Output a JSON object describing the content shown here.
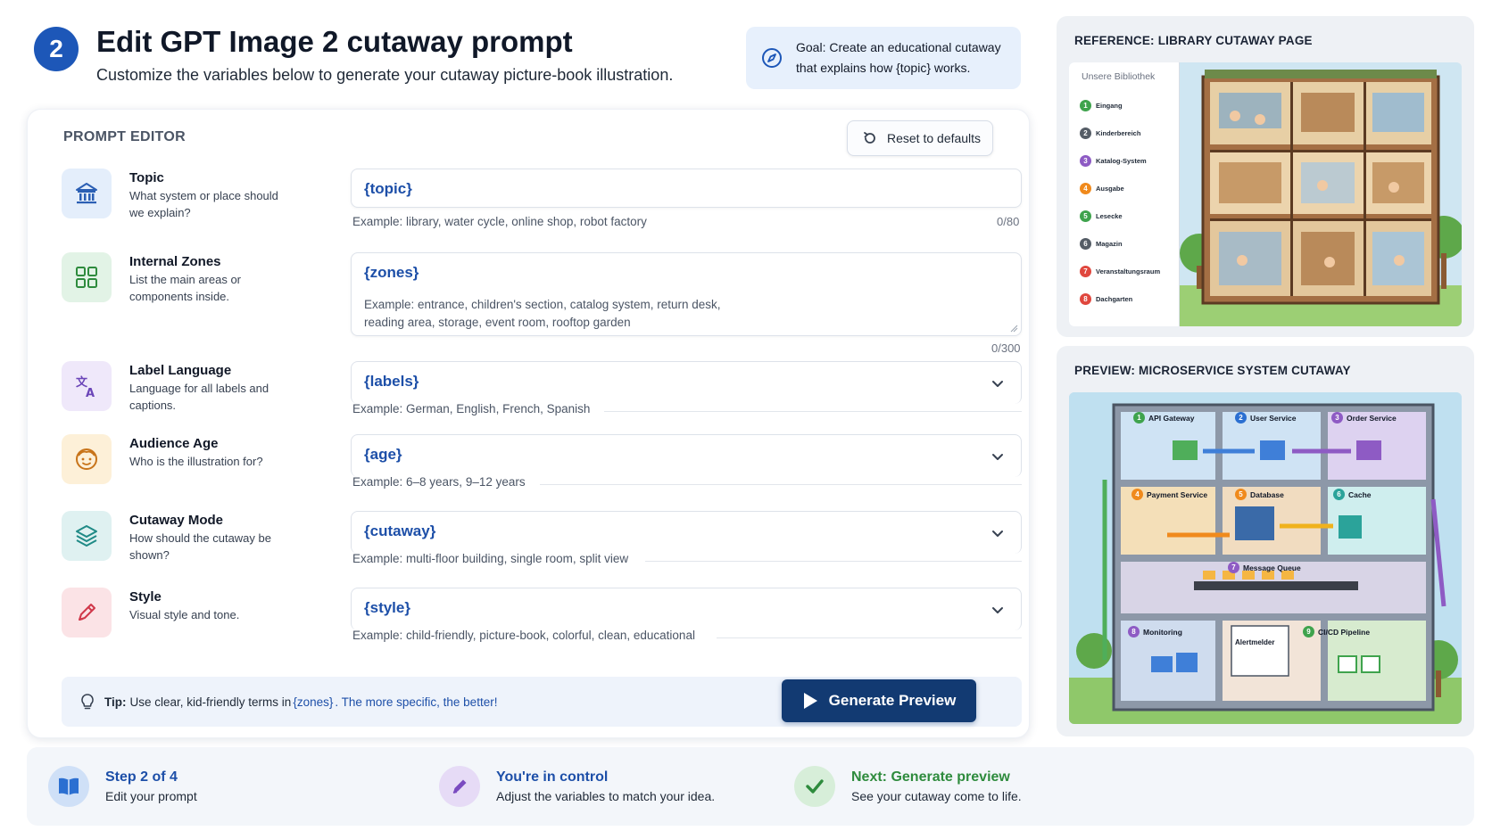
{
  "header": {
    "step_number": "2",
    "title": "Edit GPT Image 2 cutaway prompt",
    "subtitle": "Customize the variables below to generate your cutaway picture-book illustration.",
    "goal_line1": "Goal: Create an educational cutaway",
    "goal_line2": "that explains how {topic} works."
  },
  "editor": {
    "heading": "PROMPT EDITOR",
    "reset_label": "Reset to defaults",
    "rows": [
      {
        "title": "Topic",
        "desc": "What system or place should we explain?",
        "value": "{topic}",
        "hint": "Example: library, water cycle, online shop, robot factory",
        "counter": "0/80"
      },
      {
        "title": "Internal Zones",
        "desc": "List the main areas or components inside.",
        "value": "{zones}",
        "hint_line1": "Example: entrance, children's section, catalog system, return desk,",
        "hint_line2": "reading area, storage, event room, rooftop garden",
        "counter": "0/300"
      },
      {
        "title": "Label Language",
        "desc": "Language for all labels and captions.",
        "value": "{labels}",
        "hint": "Example: German, English, French, Spanish"
      },
      {
        "title": "Audience Age",
        "desc": "Who is the illustration for?",
        "value": "{age}",
        "hint": "Example: 6–8 years, 9–12 years"
      },
      {
        "title": "Cutaway Mode",
        "desc": "How should the cutaway be shown?",
        "value": "{cutaway}",
        "hint": "Example: multi-floor building, single room, split view"
      },
      {
        "title": "Style",
        "desc": "Visual style and tone.",
        "value": "{style}",
        "hint": "Example: child-friendly, picture-book, colorful, clean, educational"
      }
    ],
    "tip": {
      "label": "Tip:",
      "text": "Use clear, kid-friendly terms in",
      "var": "{zones}",
      "accent": ". The more specific, the better!"
    },
    "generate_label": "Generate Preview"
  },
  "reference": {
    "title": "REFERENCE: LIBRARY CUTAWAY PAGE",
    "legend_title": "Unsere Bibliothek",
    "legend": [
      {
        "n": "1",
        "label": "Eingang",
        "color": "#3fa34d"
      },
      {
        "n": "2",
        "label": "Kinderbereich",
        "color": "#555d66"
      },
      {
        "n": "3",
        "label": "Katalog-System",
        "color": "#8e5bc4"
      },
      {
        "n": "4",
        "label": "Ausgabe",
        "color": "#f08a1c"
      },
      {
        "n": "5",
        "label": "Lesecke",
        "color": "#3fa34d"
      },
      {
        "n": "6",
        "label": "Magazin",
        "color": "#555d66"
      },
      {
        "n": "7",
        "label": "Veranstaltungsraum",
        "color": "#e0473e"
      },
      {
        "n": "8",
        "label": "Dachgarten",
        "color": "#e0473e"
      }
    ]
  },
  "preview": {
    "title": "PREVIEW: MICROSERVICE SYSTEM CUTAWAY",
    "services": [
      {
        "n": "1",
        "label": "API Gateway",
        "color": "#3fa34d"
      },
      {
        "n": "2",
        "label": "User Service",
        "color": "#2b6fd1"
      },
      {
        "n": "3",
        "label": "Order Service",
        "color": "#8e5bc4"
      },
      {
        "n": "4",
        "label": "Payment Service",
        "color": "#f08a1c"
      },
      {
        "n": "5",
        "label": "Database",
        "color": "#f08a1c"
      },
      {
        "n": "6",
        "label": "Cache",
        "color": "#2ba39a"
      },
      {
        "n": "7",
        "label": "Message Queue",
        "color": "#8e5bc4"
      },
      {
        "n": "8",
        "label": "Monitoring",
        "color": "#8e5bc4"
      },
      {
        "n": "9",
        "label": "CI/CD Pipeline",
        "color": "#3fa34d"
      }
    ],
    "alerts_label": "Alertmelder"
  },
  "footer": [
    {
      "title": "Step 2 of 4",
      "desc": "Edit your prompt",
      "title_color": "#1d4fa8"
    },
    {
      "title": "You're in control",
      "desc": "Adjust the variables to match your idea.",
      "title_color": "#1d4fa8"
    },
    {
      "title": "Next: Generate preview",
      "desc": "See your cutaway come to life.",
      "title_color": "#2e8b3d"
    }
  ],
  "colors": {
    "accent": "#1d57b8",
    "button": "#123a72",
    "variable": "#1d4fa8"
  },
  "icons": [
    "building-icon",
    "grid-icon",
    "translate-icon",
    "face-icon",
    "layers-icon",
    "pencil-icon",
    "lightbulb-icon",
    "play-icon",
    "reset-icon",
    "chevron-down-icon",
    "book-icon",
    "check-icon",
    "compass-icon"
  ]
}
